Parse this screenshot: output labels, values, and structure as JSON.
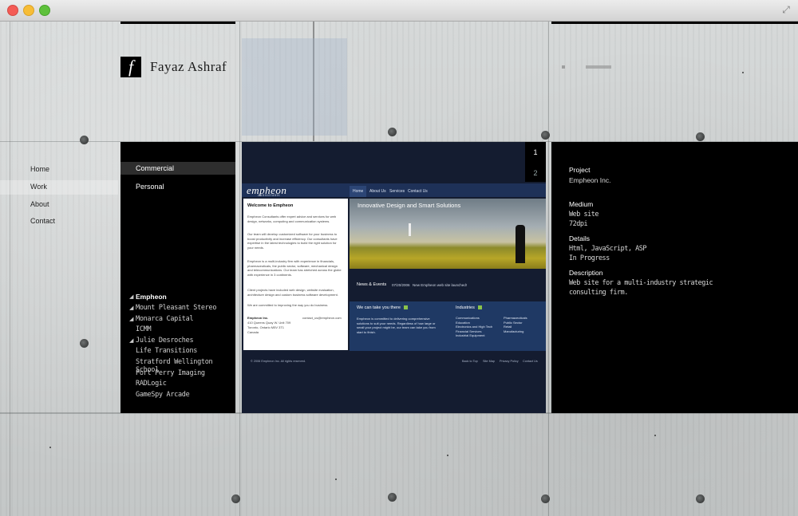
{
  "brand": {
    "name": "Fayaz Ashraf",
    "mark": "f"
  },
  "nav": {
    "items": [
      "Home",
      "Work",
      "About",
      "Contact"
    ],
    "active": "Work"
  },
  "categories": {
    "items": [
      "Commercial",
      "Personal"
    ],
    "active": "Commercial"
  },
  "projects": {
    "items": [
      "Empheon",
      "Mount Pleasant Stereo",
      "Monarca Capital",
      "ICMM",
      "Julie Desroches",
      "Life Transitions",
      "Stratford Wellington School",
      "Port Perry Imaging",
      "RADLogic",
      "GameSpy Arcade"
    ],
    "active": "Empheon"
  },
  "pager": {
    "pages": [
      "1",
      "2"
    ]
  },
  "preview": {
    "logo": "empheon",
    "logo_sub": "consultants",
    "menu": [
      "Home",
      "About Us",
      "Services",
      "Contact Us"
    ],
    "welcome_title": "Welcome to Empheon",
    "welcome_p1": "Empheon Consultants offer expert advice and services for web design, networks, computing and communication systems.",
    "welcome_p2": "Our team will develop customized software for your business to boost productivity and increase efficiency. Our consultants have expertise in the latest technologies to build the right solution for your needs.",
    "welcome_p3": "Empheon is a multi-industry firm with experience in financials, pharmaceuticals, the public sector, software, mechanical design and telecommunications. Our team has stretched across the globe with experience in 3 continents.",
    "welcome_p4": "Client projects have included web design, website evaluation, architecture design and custom business software development.",
    "welcome_p5": "We are committed to improving the way you do business.",
    "address_name": "Empheon Inc.",
    "address_line1": "410 Queens Quay W. Unit 709",
    "address_line2": "Toronto, Ontario M5V 3T1",
    "address_line3": "Canada",
    "email": "contact_us@empheon.com",
    "hero_title": "Innovative Design and Smart Solutions",
    "news_label": "News & Events",
    "news_date": "07/20/2006",
    "news_text": "New Empheon web site launched!",
    "take_title": "We can take you there",
    "take_text": "Empheon is committed to delivering comprehensive solutions to suit your needs. Regardless of how large or small your project might be, our team can take you from start to finish.",
    "industries_title": "Industries",
    "industries_col1": [
      "Communications",
      "Education",
      "Electronics and High Tech",
      "Financial Services",
      "Industrial Equipment"
    ],
    "industries_col2": [
      "Pharmaceuticals",
      "Public Sector",
      "Retail",
      "Manufacturing"
    ],
    "footer_copy": "© 2006 Empheon Inc. All rights reserved.",
    "footer_links": [
      "Back to Top",
      "Site Map",
      "Privacy Policy",
      "Contact Us"
    ]
  },
  "details": {
    "project_label": "Project",
    "project_value": "Empheon Inc.",
    "medium_label": "Medium",
    "medium_value1": "Web site",
    "medium_value2": "72dpi",
    "details_label": "Details",
    "details_value1": "Html, JavaScript, ASP",
    "details_value2": "In Progress",
    "description_label": "Description",
    "description_value1": "Web site for a multi-industry strategic",
    "description_value2": "consulting firm."
  }
}
